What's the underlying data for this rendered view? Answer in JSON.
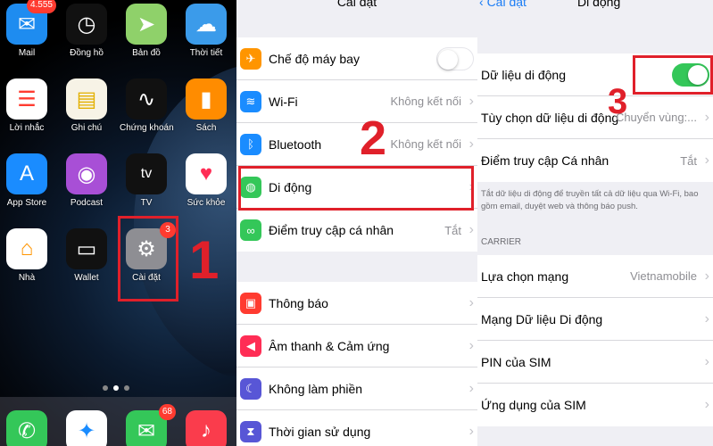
{
  "home": {
    "apps": [
      {
        "label": "Mail",
        "icon": "mail-icon",
        "badge": "4.555",
        "color": "#1e8cf0"
      },
      {
        "label": "Đồng hồ",
        "icon": "clock-icon",
        "badge": "",
        "color": "#111111"
      },
      {
        "label": "Bản đồ",
        "icon": "map-icon",
        "badge": "",
        "color": "#8fd16a"
      },
      {
        "label": "Thời tiết",
        "icon": "weather-icon",
        "badge": "",
        "color": "#3b9bea"
      },
      {
        "label": "Lời nhắc",
        "icon": "reminders-icon",
        "badge": "",
        "color": "#ffffff"
      },
      {
        "label": "Ghi chú",
        "icon": "notes-icon",
        "badge": "",
        "color": "#f7f3e6"
      },
      {
        "label": "Chứng khoán",
        "icon": "stocks-icon",
        "badge": "",
        "color": "#111111"
      },
      {
        "label": "Sách",
        "icon": "books-icon",
        "badge": "",
        "color": "#ff8c00"
      },
      {
        "label": "App Store",
        "icon": "app-store-icon",
        "badge": "",
        "color": "#1a8cff"
      },
      {
        "label": "Podcast",
        "icon": "podcast-icon",
        "badge": "",
        "color": "#a84fd6"
      },
      {
        "label": "TV",
        "icon": "tv-icon",
        "badge": "",
        "color": "#111111"
      },
      {
        "label": "Sức khỏe",
        "icon": "health-icon",
        "badge": "",
        "color": "#ffffff"
      },
      {
        "label": "Nhà",
        "icon": "home-icon",
        "badge": "",
        "color": "#ffffff"
      },
      {
        "label": "Wallet",
        "icon": "wallet-icon",
        "badge": "",
        "color": "#111111"
      },
      {
        "label": "Cài đặt",
        "icon": "settings-gear-icon",
        "badge": "3",
        "color": "#8e8e93"
      }
    ],
    "tv_tile_text": "tv",
    "dock": [
      {
        "icon": "phone-icon",
        "badge": "",
        "color": "#34c759"
      },
      {
        "icon": "safari-icon",
        "badge": "",
        "color": "#ffffff"
      },
      {
        "icon": "messages-icon",
        "badge": "68",
        "color": "#34c759"
      },
      {
        "icon": "music-icon",
        "badge": "",
        "color": "#fa3c4c"
      }
    ],
    "step": "1"
  },
  "settings": {
    "title": "Cài đặt",
    "group1": [
      {
        "label": "Chế độ máy bay",
        "value": "",
        "icon": "airplane-icon",
        "color": "#ff9500",
        "toggle": "off"
      },
      {
        "label": "Wi-Fi",
        "value": "Không kết nối",
        "icon": "wifi-icon",
        "color": "#1a8cff"
      },
      {
        "label": "Bluetooth",
        "value": "Không kết nối",
        "icon": "bluetooth-icon",
        "color": "#1a8cff"
      },
      {
        "label": "Di động",
        "value": "",
        "icon": "cellular-icon",
        "color": "#34c759"
      },
      {
        "label": "Điểm truy cập cá nhân",
        "value": "Tắt",
        "icon": "hotspot-icon",
        "color": "#34c759"
      }
    ],
    "group2": [
      {
        "label": "Thông báo",
        "icon": "notifications-icon",
        "color": "#ff3b30"
      },
      {
        "label": "Âm thanh & Cảm ứng",
        "icon": "sound-icon",
        "color": "#ff2d55"
      },
      {
        "label": "Không làm phiền",
        "icon": "moon-icon",
        "color": "#5856d6"
      },
      {
        "label": "Thời gian sử dụng",
        "icon": "hourglass-icon",
        "color": "#5856d6"
      }
    ],
    "step": "2"
  },
  "mobile": {
    "back_label": "Cài đặt",
    "title": "Di động",
    "group1": [
      {
        "label": "Dữ liệu di động",
        "value": "",
        "toggle": "on"
      },
      {
        "label": "Tùy chọn dữ liệu di động",
        "value": "Chuyển vùng:..."
      },
      {
        "label": "Điểm truy cập Cá nhân",
        "value": "Tắt"
      }
    ],
    "note": "Tắt dữ liệu di động để truyền tất cả dữ liệu qua Wi-Fi, bao gồm email, duyệt web và thông báo push.",
    "section_header": "CARRIER",
    "group2": [
      {
        "label": "Lựa chọn mạng",
        "value": "Vietnamobile"
      },
      {
        "label": "Mạng Dữ liệu Di động",
        "value": ""
      },
      {
        "label": "PIN của SIM",
        "value": ""
      },
      {
        "label": "Ứng dụng của SIM",
        "value": ""
      }
    ],
    "step": "3"
  },
  "colors": {
    "highlight": "#e0202a",
    "toggle_on": "#34c759",
    "toggle_off": "#e5e5ea",
    "link": "#1a7cf5"
  }
}
